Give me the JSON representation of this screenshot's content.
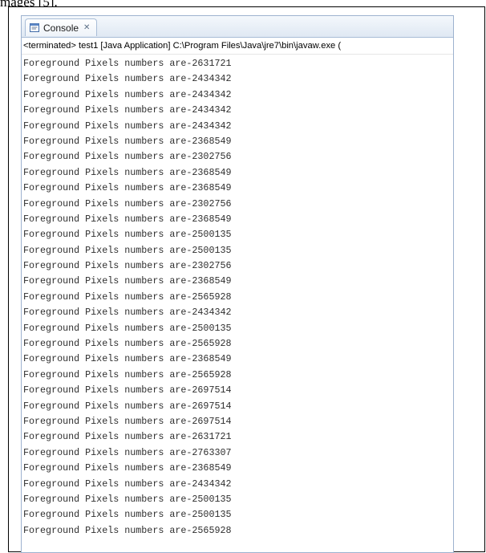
{
  "caption": {
    "fragment": "mages [5]."
  },
  "console": {
    "tab_label": "Console",
    "tab_close_glyph": "✕",
    "tab_icon": "console-icon",
    "status_line": "<terminated> test1 [Java Application] C:\\Program Files\\Java\\jre7\\bin\\javaw.exe (",
    "lines": [
      "Foreground Pixels numbers are-2631721",
      "Foreground Pixels numbers are-2434342",
      "Foreground Pixels numbers are-2434342",
      "Foreground Pixels numbers are-2434342",
      "Foreground Pixels numbers are-2434342",
      "Foreground Pixels numbers are-2368549",
      "Foreground Pixels numbers are-2302756",
      "Foreground Pixels numbers are-2368549",
      "Foreground Pixels numbers are-2368549",
      "Foreground Pixels numbers are-2302756",
      "Foreground Pixels numbers are-2368549",
      "Foreground Pixels numbers are-2500135",
      "Foreground Pixels numbers are-2500135",
      "Foreground Pixels numbers are-2302756",
      "Foreground Pixels numbers are-2368549",
      "Foreground Pixels numbers are-2565928",
      "Foreground Pixels numbers are-2434342",
      "Foreground Pixels numbers are-2500135",
      "Foreground Pixels numbers are-2565928",
      "Foreground Pixels numbers are-2368549",
      "Foreground Pixels numbers are-2565928",
      "Foreground Pixels numbers are-2697514",
      "Foreground Pixels numbers are-2697514",
      "Foreground Pixels numbers are-2697514",
      "Foreground Pixels numbers are-2631721",
      "Foreground Pixels numbers are-2763307",
      "Foreground Pixels numbers are-2368549",
      "Foreground Pixels numbers are-2434342",
      "Foreground Pixels numbers are-2500135",
      "Foreground Pixels numbers are-2500135",
      "Foreground Pixels numbers are-2565928"
    ]
  },
  "colors": {
    "tab_border": "#a9bdd7",
    "view_border": "#9db2cf",
    "output_text": "#2e2e2e"
  }
}
